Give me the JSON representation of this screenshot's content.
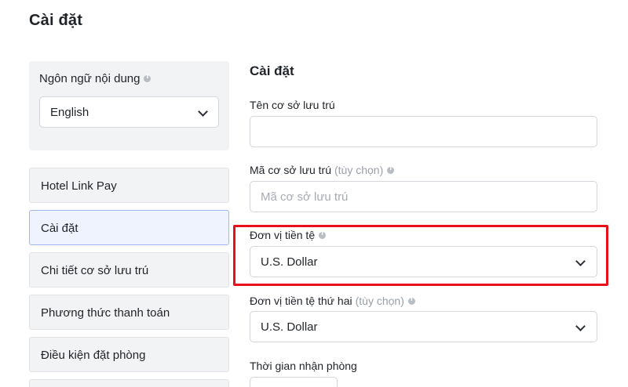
{
  "header": {
    "title": "Cài đặt"
  },
  "sidebar": {
    "language": {
      "label": "Ngôn ngữ nội dung",
      "selected": "English"
    },
    "items": [
      {
        "label": "Hotel Link Pay"
      },
      {
        "label": "Cài đặt"
      },
      {
        "label": "Chi tiết cơ sở lưu trú"
      },
      {
        "label": "Phương thức thanh toán"
      },
      {
        "label": "Điều kiện đặt phòng"
      }
    ],
    "active_item": "Cài đặt"
  },
  "main": {
    "section_title": "Cài đặt",
    "property_name": {
      "label": "Tên cơ sở lưu trú",
      "value": ""
    },
    "property_code": {
      "label": "Mã cơ sở lưu trú",
      "optional": "(tùy chọn)",
      "placeholder": "Mã cơ sở lưu trú",
      "value": ""
    },
    "currency": {
      "label": "Đơn vị tiền tệ",
      "selected": "U.S. Dollar"
    },
    "secondary_currency": {
      "label": "Đơn vị tiền tệ thứ hai",
      "optional": "(tùy chọn)",
      "selected": "U.S. Dollar"
    },
    "checkin_time": {
      "label": "Thời gian nhận phòng"
    }
  },
  "colors": {
    "highlight": "#e8111b",
    "active_nav_bg": "#eef3fd",
    "active_nav_border": "#9fb8ef",
    "card_bg": "#f2f3f5"
  }
}
